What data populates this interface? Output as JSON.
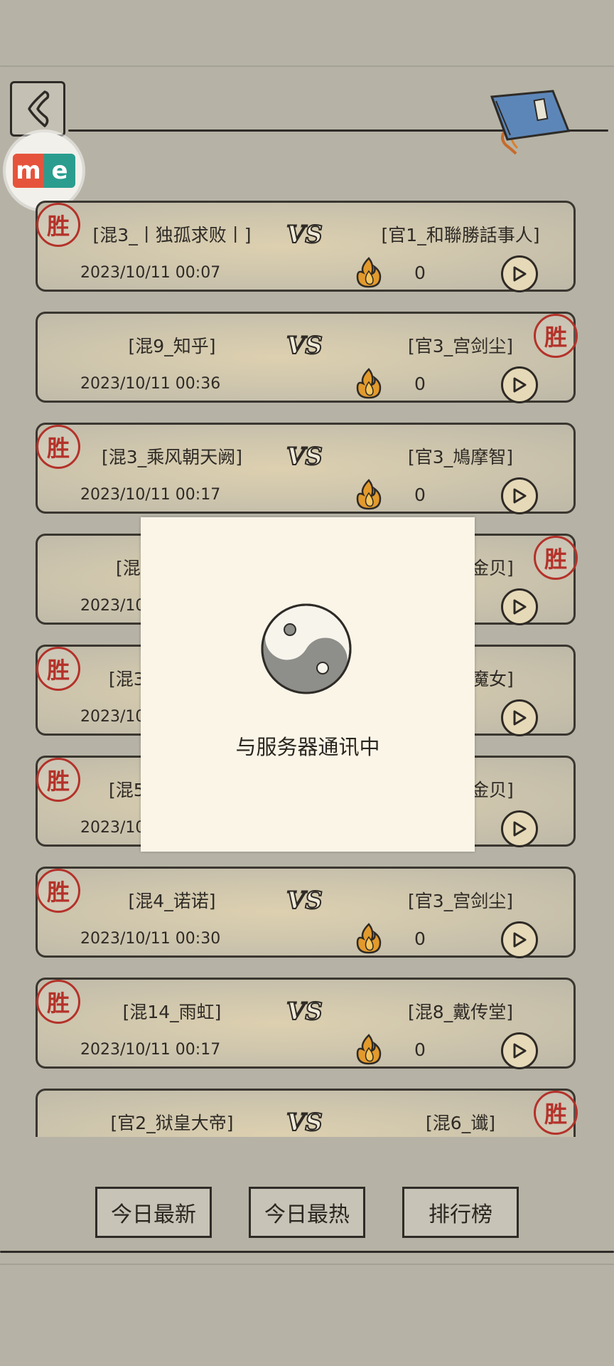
{
  "header": {
    "back_icon": "chevron-left-icon",
    "logo_letters": [
      "m",
      "e"
    ],
    "book_icon": "book-icon"
  },
  "matches": [
    {
      "left": "[混3_丨独孤求败丨]",
      "right": "[官1_和聯勝話事人]",
      "date": "2023/10/11 00:07",
      "count": "0",
      "winner": "left"
    },
    {
      "left": "[混9_知乎]",
      "right": "[官3_宫剑尘]",
      "date": "2023/10/11 00:36",
      "count": "0",
      "winner": "right"
    },
    {
      "left": "[混3_乘风朝天阙]",
      "right": "[官3_鳩摩智]",
      "date": "2023/10/11 00:17",
      "count": "0",
      "winner": "left"
    },
    {
      "left": "[混",
      "right": "金贝]",
      "date": "2023/10",
      "count": "",
      "winner": "right"
    },
    {
      "left": "[混3",
      "right": "魔女]",
      "date": "2023/10",
      "count": "",
      "winner": "left"
    },
    {
      "left": "[混5",
      "right": "金贝]",
      "date": "2023/10",
      "count": "",
      "winner": "left"
    },
    {
      "left": "[混4_诺诺]",
      "right": "[官3_宫剑尘]",
      "date": "2023/10/11 00:30",
      "count": "0",
      "winner": "left"
    },
    {
      "left": "[混14_雨虹]",
      "right": "[混8_戴传堂]",
      "date": "2023/10/11 00:17",
      "count": "0",
      "winner": "left"
    },
    {
      "left": "[官2_狱皇大帝]",
      "right": "[混6_谶]",
      "date": "",
      "count": "",
      "winner": "right"
    }
  ],
  "seal_text": "胜",
  "modal": {
    "text": "与服务器通讯中"
  },
  "tabs": [
    {
      "label": "今日最新"
    },
    {
      "label": "今日最热"
    },
    {
      "label": "排行榜"
    }
  ],
  "colors": {
    "background": "#b6b3a6",
    "seal": "#b4322a",
    "modal_bg": "#fbf5e8"
  }
}
